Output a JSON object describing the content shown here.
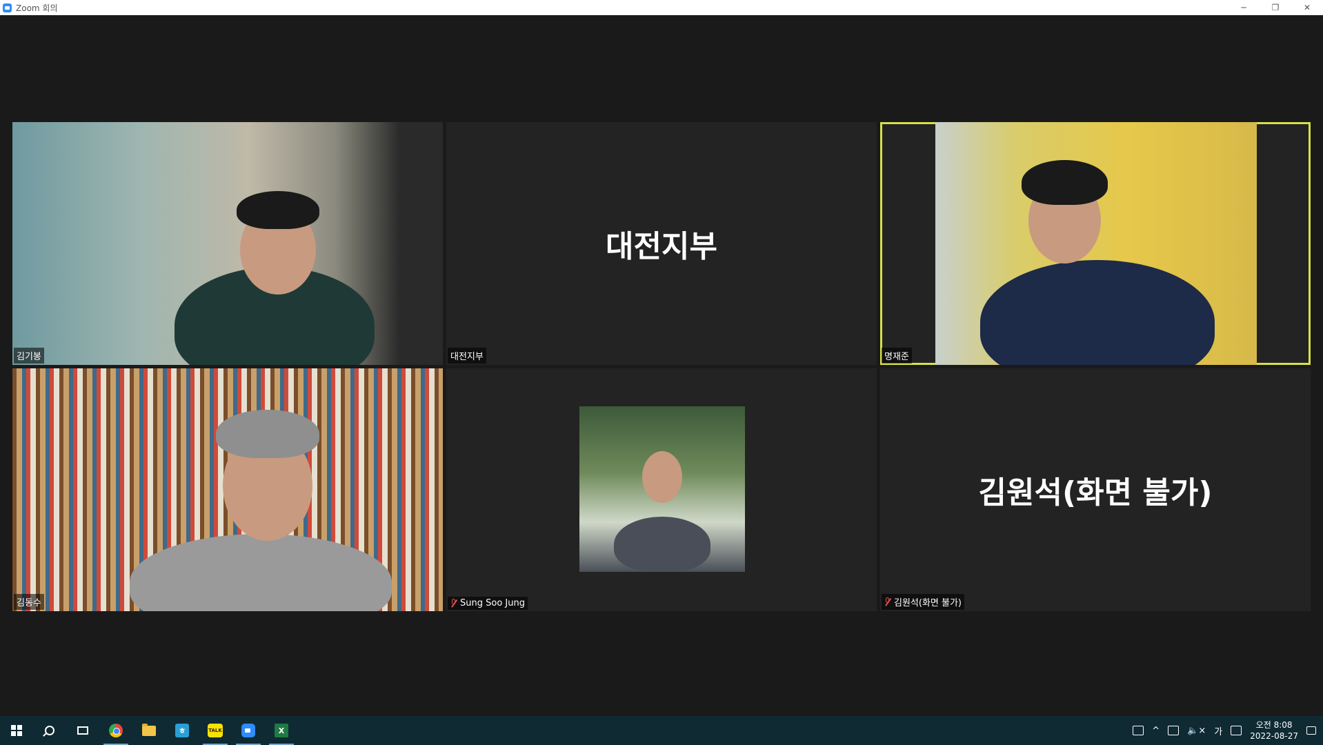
{
  "window": {
    "title": "Zoom 회의",
    "min": "─",
    "restore": "❐",
    "close": "✕"
  },
  "participants": [
    {
      "name": "김기봉",
      "video": true,
      "muted": false,
      "active": false
    },
    {
      "name": "대전지부",
      "video": false,
      "muted": false,
      "active": false,
      "display_text": "대전지부"
    },
    {
      "name": "명재준",
      "video": true,
      "muted": false,
      "active": true
    },
    {
      "name": "김동수",
      "video": true,
      "muted": false,
      "active": false
    },
    {
      "name": "Sung Soo Jung",
      "video": true,
      "muted": true,
      "active": false
    },
    {
      "name": "김원석(화면 불가)",
      "video": false,
      "muted": true,
      "active": false,
      "display_text": "김원석(화면 불가)"
    }
  ],
  "taskbar": {
    "apps": [
      "start",
      "search",
      "task-view",
      "chrome",
      "file-explorer",
      "hanword",
      "kakaotalk",
      "zoom",
      "excel"
    ],
    "kakao_label": "TALK",
    "hanword_label": "ㅎ",
    "excel_label": "X",
    "tray": {
      "chevron": "^",
      "volume": "🔈×",
      "ime": "가",
      "time_label": "오전 8:08",
      "date": "2022-08-27"
    }
  },
  "colors": {
    "active_speaker_border": "#d7e04a",
    "background": "#1a1a1a",
    "tile": "#232323",
    "taskbar": "#0f2a33"
  }
}
